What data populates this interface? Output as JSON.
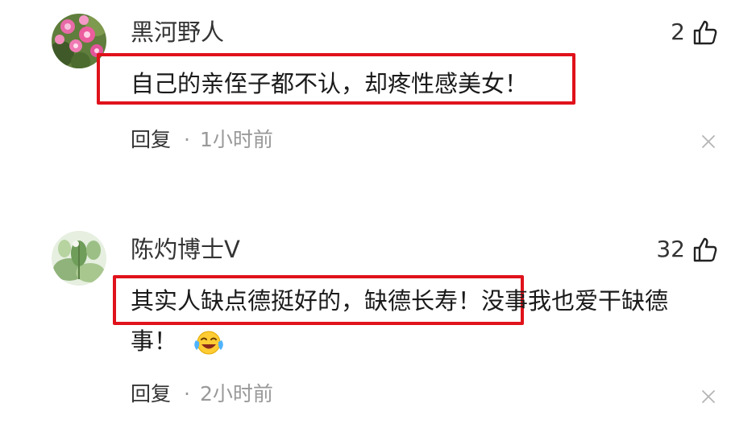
{
  "comments": [
    {
      "username": "黑河野人",
      "likes": "2",
      "text": "自己的亲侄子都不认，却疼性感美女！",
      "reply_label": "回复",
      "separator": "·",
      "time": "1小时前",
      "avatar_icon": "pink-flowers-avatar",
      "like_icon": "thumbs-up-icon",
      "close_icon": "close-icon"
    },
    {
      "username": "陈灼博士V",
      "likes": "32",
      "text_line1": "其实人缺点德挺好的，缺德长寿！没事我也爱干缺德",
      "text_line2": "事！",
      "reply_label": "回复",
      "separator": "·",
      "time": "2小时前",
      "avatar_icon": "green-plant-avatar",
      "emoji_icon": "laugh-cry-emoji",
      "like_icon": "thumbs-up-icon",
      "close_icon": "close-icon"
    }
  ],
  "colors": {
    "highlight_border": "#e0121b",
    "secondary_text": "#999999",
    "primary_text": "#1a1a1a"
  }
}
